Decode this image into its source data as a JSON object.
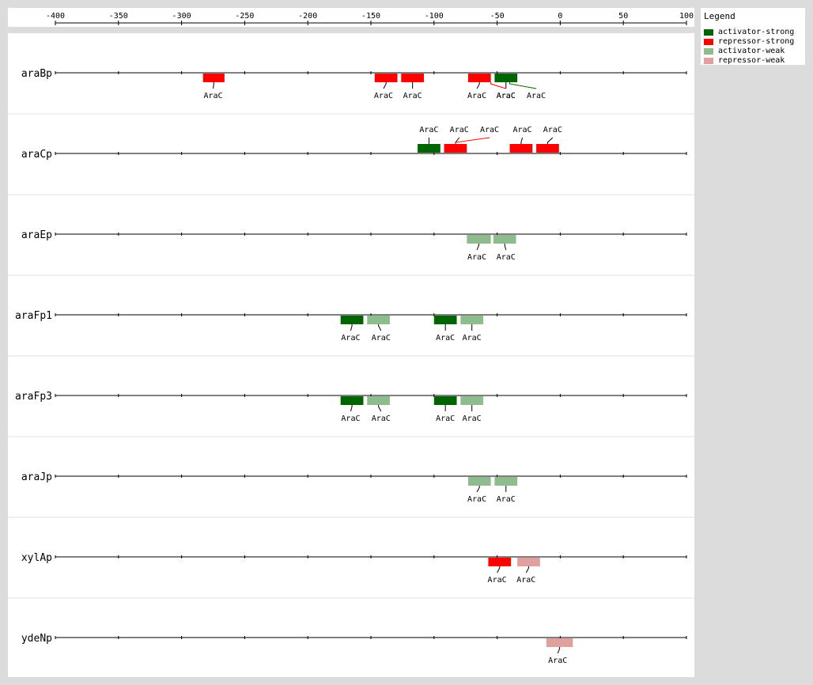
{
  "axis": {
    "min": -400,
    "max": 100,
    "ticks": [
      -400,
      -350,
      -300,
      -250,
      -200,
      -150,
      -100,
      -50,
      0,
      50,
      100
    ],
    "tick_labels": [
      "-400",
      "-350",
      "-300",
      "-250",
      "-200",
      "-150",
      "-100",
      "-50",
      "0",
      "50",
      "100"
    ]
  },
  "legend": {
    "title": "Legend",
    "items": [
      {
        "label": "activator-strong",
        "color": "#006400"
      },
      {
        "label": "repressor-strong",
        "color": "#ff0000"
      },
      {
        "label": "activator-weak",
        "color": "#8fbc8f"
      },
      {
        "label": "repressor-weak",
        "color": "#e0a0a0"
      }
    ]
  },
  "chart_data": {
    "type": "promoter-binding-site-map",
    "x_range": [
      -400,
      100
    ],
    "promoters": [
      {
        "name": "araBp",
        "sites": [
          {
            "label": "AraC",
            "start": -283,
            "end": -266,
            "kind": "repressor-strong",
            "label_pos": "below",
            "label_x": -275
          },
          {
            "label": "AraC",
            "start": -147,
            "end": -129,
            "kind": "repressor-strong",
            "label_pos": "below",
            "label_x": -140
          },
          {
            "label": "AraC",
            "start": -126,
            "end": -108,
            "kind": "repressor-strong",
            "label_pos": "below",
            "label_x": -117
          },
          {
            "label": "AraC",
            "start": -73,
            "end": -55,
            "kind": "repressor-strong",
            "label_pos": "below",
            "label_x": -66
          },
          {
            "label": "AraC",
            "start": -52,
            "end": -34,
            "kind": "activator-strong",
            "label_pos": "below",
            "label_x": -43
          },
          {
            "label": "AraC",
            "start": -70,
            "end": -40,
            "kind": "repressor-strong",
            "label_pos": "below",
            "label_x": -43,
            "overlap": true
          },
          {
            "label": "AraC",
            "start": -50,
            "end": -30,
            "kind": "activator-strong",
            "label_pos": "below",
            "label_x": -19,
            "overlap": true
          }
        ]
      },
      {
        "name": "araCp",
        "sites": [
          {
            "label": "AraC",
            "start": -113,
            "end": -95,
            "kind": "activator-strong",
            "label_pos": "above",
            "label_x": -104
          },
          {
            "label": "AraC",
            "start": -92,
            "end": -74,
            "kind": "repressor-strong",
            "label_pos": "above",
            "label_x": -80
          },
          {
            "label": "AraC",
            "start": -92,
            "end": -74,
            "kind": "repressor-strong",
            "label_pos": "above",
            "label_x": -56,
            "overlap": true
          },
          {
            "label": "AraC",
            "start": -40,
            "end": -22,
            "kind": "repressor-strong",
            "label_pos": "above",
            "label_x": -30
          },
          {
            "label": "AraC",
            "start": -19,
            "end": -1,
            "kind": "repressor-strong",
            "label_pos": "above",
            "label_x": -6
          }
        ]
      },
      {
        "name": "araEp",
        "sites": [
          {
            "label": "AraC",
            "start": -74,
            "end": -55,
            "kind": "activator-weak",
            "label_pos": "below",
            "label_x": -66
          },
          {
            "label": "AraC",
            "start": -53,
            "end": -35,
            "kind": "activator-weak",
            "label_pos": "below",
            "label_x": -43
          }
        ]
      },
      {
        "name": "araFp1",
        "sites": [
          {
            "label": "AraC",
            "start": -174,
            "end": -156,
            "kind": "activator-strong",
            "label_pos": "below",
            "label_x": -166
          },
          {
            "label": "AraC",
            "start": -153,
            "end": -135,
            "kind": "activator-weak",
            "label_pos": "below",
            "label_x": -142
          },
          {
            "label": "AraC",
            "start": -100,
            "end": -82,
            "kind": "activator-strong",
            "label_pos": "below",
            "label_x": -91
          },
          {
            "label": "AraC",
            "start": -79,
            "end": -61,
            "kind": "activator-weak",
            "label_pos": "below",
            "label_x": -70
          }
        ]
      },
      {
        "name": "araFp3",
        "sites": [
          {
            "label": "AraC",
            "start": -174,
            "end": -156,
            "kind": "activator-strong",
            "label_pos": "below",
            "label_x": -166
          },
          {
            "label": "AraC",
            "start": -153,
            "end": -135,
            "kind": "activator-weak",
            "label_pos": "below",
            "label_x": -142
          },
          {
            "label": "AraC",
            "start": -100,
            "end": -82,
            "kind": "activator-strong",
            "label_pos": "below",
            "label_x": -91
          },
          {
            "label": "AraC",
            "start": -79,
            "end": -61,
            "kind": "activator-weak",
            "label_pos": "below",
            "label_x": -70
          }
        ]
      },
      {
        "name": "araJp",
        "sites": [
          {
            "label": "AraC",
            "start": -73,
            "end": -55,
            "kind": "activator-weak",
            "label_pos": "below",
            "label_x": -66
          },
          {
            "label": "AraC",
            "start": -52,
            "end": -34,
            "kind": "activator-weak",
            "label_pos": "below",
            "label_x": -43
          }
        ]
      },
      {
        "name": "xylAp",
        "sites": [
          {
            "label": "AraC",
            "start": -57,
            "end": -39,
            "kind": "repressor-strong",
            "label_pos": "below",
            "label_x": -50
          },
          {
            "label": "AraC",
            "start": -34,
            "end": -16,
            "kind": "repressor-weak",
            "label_pos": "below",
            "label_x": -27
          }
        ]
      },
      {
        "name": "ydeNp",
        "sites": [
          {
            "label": "AraC",
            "start": -11,
            "end": 10,
            "kind": "repressor-weak",
            "label_pos": "below",
            "label_x": -2
          }
        ]
      }
    ]
  }
}
